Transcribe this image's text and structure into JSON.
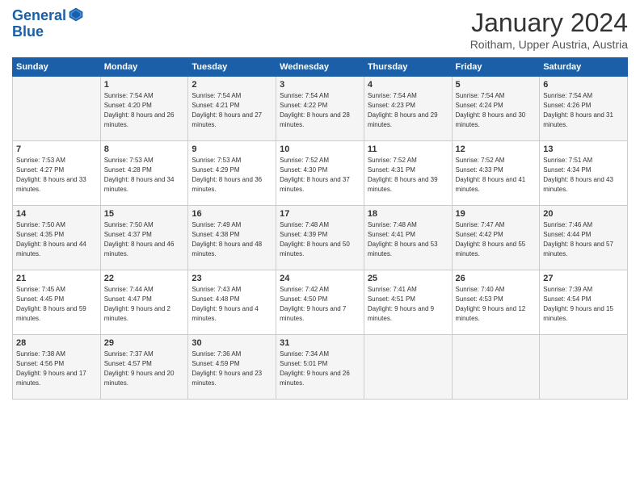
{
  "logo": {
    "line1": "General",
    "line2": "Blue"
  },
  "title": "January 2024",
  "subtitle": "Roitham, Upper Austria, Austria",
  "header": {
    "days": [
      "Sunday",
      "Monday",
      "Tuesday",
      "Wednesday",
      "Thursday",
      "Friday",
      "Saturday"
    ]
  },
  "weeks": [
    [
      {
        "day": "",
        "sunrise": "",
        "sunset": "",
        "daylight": ""
      },
      {
        "day": "1",
        "sunrise": "Sunrise: 7:54 AM",
        "sunset": "Sunset: 4:20 PM",
        "daylight": "Daylight: 8 hours and 26 minutes."
      },
      {
        "day": "2",
        "sunrise": "Sunrise: 7:54 AM",
        "sunset": "Sunset: 4:21 PM",
        "daylight": "Daylight: 8 hours and 27 minutes."
      },
      {
        "day": "3",
        "sunrise": "Sunrise: 7:54 AM",
        "sunset": "Sunset: 4:22 PM",
        "daylight": "Daylight: 8 hours and 28 minutes."
      },
      {
        "day": "4",
        "sunrise": "Sunrise: 7:54 AM",
        "sunset": "Sunset: 4:23 PM",
        "daylight": "Daylight: 8 hours and 29 minutes."
      },
      {
        "day": "5",
        "sunrise": "Sunrise: 7:54 AM",
        "sunset": "Sunset: 4:24 PM",
        "daylight": "Daylight: 8 hours and 30 minutes."
      },
      {
        "day": "6",
        "sunrise": "Sunrise: 7:54 AM",
        "sunset": "Sunset: 4:26 PM",
        "daylight": "Daylight: 8 hours and 31 minutes."
      }
    ],
    [
      {
        "day": "7",
        "sunrise": "Sunrise: 7:53 AM",
        "sunset": "Sunset: 4:27 PM",
        "daylight": "Daylight: 8 hours and 33 minutes."
      },
      {
        "day": "8",
        "sunrise": "Sunrise: 7:53 AM",
        "sunset": "Sunset: 4:28 PM",
        "daylight": "Daylight: 8 hours and 34 minutes."
      },
      {
        "day": "9",
        "sunrise": "Sunrise: 7:53 AM",
        "sunset": "Sunset: 4:29 PM",
        "daylight": "Daylight: 8 hours and 36 minutes."
      },
      {
        "day": "10",
        "sunrise": "Sunrise: 7:52 AM",
        "sunset": "Sunset: 4:30 PM",
        "daylight": "Daylight: 8 hours and 37 minutes."
      },
      {
        "day": "11",
        "sunrise": "Sunrise: 7:52 AM",
        "sunset": "Sunset: 4:31 PM",
        "daylight": "Daylight: 8 hours and 39 minutes."
      },
      {
        "day": "12",
        "sunrise": "Sunrise: 7:52 AM",
        "sunset": "Sunset: 4:33 PM",
        "daylight": "Daylight: 8 hours and 41 minutes."
      },
      {
        "day": "13",
        "sunrise": "Sunrise: 7:51 AM",
        "sunset": "Sunset: 4:34 PM",
        "daylight": "Daylight: 8 hours and 43 minutes."
      }
    ],
    [
      {
        "day": "14",
        "sunrise": "Sunrise: 7:50 AM",
        "sunset": "Sunset: 4:35 PM",
        "daylight": "Daylight: 8 hours and 44 minutes."
      },
      {
        "day": "15",
        "sunrise": "Sunrise: 7:50 AM",
        "sunset": "Sunset: 4:37 PM",
        "daylight": "Daylight: 8 hours and 46 minutes."
      },
      {
        "day": "16",
        "sunrise": "Sunrise: 7:49 AM",
        "sunset": "Sunset: 4:38 PM",
        "daylight": "Daylight: 8 hours and 48 minutes."
      },
      {
        "day": "17",
        "sunrise": "Sunrise: 7:48 AM",
        "sunset": "Sunset: 4:39 PM",
        "daylight": "Daylight: 8 hours and 50 minutes."
      },
      {
        "day": "18",
        "sunrise": "Sunrise: 7:48 AM",
        "sunset": "Sunset: 4:41 PM",
        "daylight": "Daylight: 8 hours and 53 minutes."
      },
      {
        "day": "19",
        "sunrise": "Sunrise: 7:47 AM",
        "sunset": "Sunset: 4:42 PM",
        "daylight": "Daylight: 8 hours and 55 minutes."
      },
      {
        "day": "20",
        "sunrise": "Sunrise: 7:46 AM",
        "sunset": "Sunset: 4:44 PM",
        "daylight": "Daylight: 8 hours and 57 minutes."
      }
    ],
    [
      {
        "day": "21",
        "sunrise": "Sunrise: 7:45 AM",
        "sunset": "Sunset: 4:45 PM",
        "daylight": "Daylight: 8 hours and 59 minutes."
      },
      {
        "day": "22",
        "sunrise": "Sunrise: 7:44 AM",
        "sunset": "Sunset: 4:47 PM",
        "daylight": "Daylight: 9 hours and 2 minutes."
      },
      {
        "day": "23",
        "sunrise": "Sunrise: 7:43 AM",
        "sunset": "Sunset: 4:48 PM",
        "daylight": "Daylight: 9 hours and 4 minutes."
      },
      {
        "day": "24",
        "sunrise": "Sunrise: 7:42 AM",
        "sunset": "Sunset: 4:50 PM",
        "daylight": "Daylight: 9 hours and 7 minutes."
      },
      {
        "day": "25",
        "sunrise": "Sunrise: 7:41 AM",
        "sunset": "Sunset: 4:51 PM",
        "daylight": "Daylight: 9 hours and 9 minutes."
      },
      {
        "day": "26",
        "sunrise": "Sunrise: 7:40 AM",
        "sunset": "Sunset: 4:53 PM",
        "daylight": "Daylight: 9 hours and 12 minutes."
      },
      {
        "day": "27",
        "sunrise": "Sunrise: 7:39 AM",
        "sunset": "Sunset: 4:54 PM",
        "daylight": "Daylight: 9 hours and 15 minutes."
      }
    ],
    [
      {
        "day": "28",
        "sunrise": "Sunrise: 7:38 AM",
        "sunset": "Sunset: 4:56 PM",
        "daylight": "Daylight: 9 hours and 17 minutes."
      },
      {
        "day": "29",
        "sunrise": "Sunrise: 7:37 AM",
        "sunset": "Sunset: 4:57 PM",
        "daylight": "Daylight: 9 hours and 20 minutes."
      },
      {
        "day": "30",
        "sunrise": "Sunrise: 7:36 AM",
        "sunset": "Sunset: 4:59 PM",
        "daylight": "Daylight: 9 hours and 23 minutes."
      },
      {
        "day": "31",
        "sunrise": "Sunrise: 7:34 AM",
        "sunset": "Sunset: 5:01 PM",
        "daylight": "Daylight: 9 hours and 26 minutes."
      },
      {
        "day": "",
        "sunrise": "",
        "sunset": "",
        "daylight": ""
      },
      {
        "day": "",
        "sunrise": "",
        "sunset": "",
        "daylight": ""
      },
      {
        "day": "",
        "sunrise": "",
        "sunset": "",
        "daylight": ""
      }
    ]
  ]
}
